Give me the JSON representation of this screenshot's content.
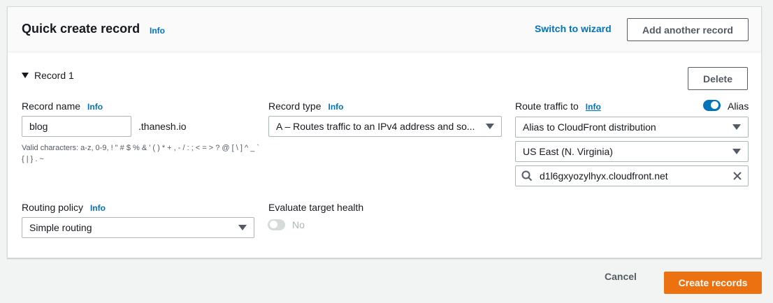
{
  "header": {
    "title": "Quick create record",
    "info": "Info",
    "switch_link": "Switch to wizard",
    "add_button": "Add another record"
  },
  "record": {
    "toggle_label": "Record 1",
    "delete_button": "Delete",
    "record_name": {
      "label": "Record name",
      "info": "Info",
      "value": "blog",
      "suffix": ".thanesh.io",
      "hint": "Valid characters: a-z, 0-9, ! \" # $ % & ' ( ) * + , - / : ; < = > ? @ [ \\ ] ^ _ ` { | } . ~"
    },
    "record_type": {
      "label": "Record type",
      "info": "Info",
      "value": "A – Routes traffic to an IPv4 address and so..."
    },
    "route_traffic": {
      "label": "Route traffic to",
      "info": "Info",
      "alias_label": "Alias",
      "alias_enabled": true,
      "target_type": "Alias to CloudFront distribution",
      "region": "US East (N. Virginia)",
      "endpoint": "d1l6gxyozylhyx.cloudfront.net"
    },
    "routing_policy": {
      "label": "Routing policy",
      "info": "Info",
      "value": "Simple routing"
    },
    "evaluate_health": {
      "label": "Evaluate target health",
      "value_label": "No",
      "enabled": false
    }
  },
  "footer": {
    "cancel": "Cancel",
    "create": "Create records"
  },
  "colors": {
    "accent": "#0073bb",
    "primary": "#ec7211"
  },
  "icons": [
    "caret-down-icon",
    "dropdown-arrow-icon",
    "search-icon",
    "clear-icon",
    "toggle-switch-icon"
  ]
}
